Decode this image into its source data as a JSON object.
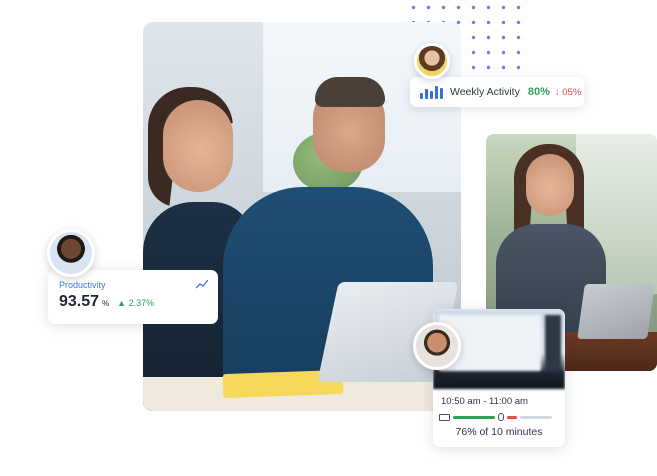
{
  "weekly_activity": {
    "label": "Weekly Activity",
    "value": "80%",
    "delta": "↓ 05%",
    "icon": "bar-chart-icon",
    "colors": {
      "value": "#2fa35a",
      "delta": "#e04b4b",
      "icon": "#3b6fd6"
    }
  },
  "productivity": {
    "title": "Productivity",
    "value": "93.57",
    "unit": "%",
    "delta": "▲ 2.37%",
    "icon": "trend-up-icon",
    "colors": {
      "title": "#3a78d8",
      "delta": "#2fa35a"
    }
  },
  "timeline": {
    "range": "10:50 am - 11:00 am",
    "summary": "76% of 10 minutes",
    "icons": [
      "keyboard-icon",
      "mouse-icon"
    ],
    "colors": {
      "keyboard_segment": "#2fa35a",
      "mouse_segment": "#e04b4b",
      "idle_segment": "#d4d9e0"
    }
  },
  "decor": {
    "dots_color": "#3a78d8"
  }
}
